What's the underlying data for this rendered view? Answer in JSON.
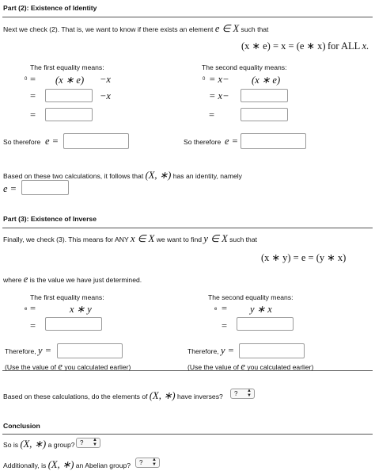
{
  "part2": {
    "title": "Part (2): Existence of Identity",
    "intro_text": "Next we check (2). That is, we want to know if there exists an element",
    "intro_math": "e ∈ X",
    "intro_suffix": "such that",
    "equation_left": "(x ∗ e) = x = (e ∗ x)",
    "equation_for": "for ALL",
    "equation_var": "x.",
    "first_label": "The first equality means:",
    "second_label": "The second equality means:",
    "first_row0": [
      "0",
      "=",
      "(x ∗ e)",
      "−x"
    ],
    "first_row1": [
      "=",
      "−x"
    ],
    "first_row2": [
      "="
    ],
    "second_row0": [
      "0",
      "= x−",
      "(x ∗ e)"
    ],
    "second_row1": [
      "= x−"
    ],
    "second_row2": [
      "="
    ],
    "so_therefore": "So therefore",
    "e_eq": "e =",
    "conclusion_text": "Based on these two calculations, it follows that",
    "conclusion_group": "(X, ∗)",
    "conclusion_suffix": "has an identity, namely",
    "e_line": "e ="
  },
  "part3": {
    "title": "Part (3): Existence of Inverse",
    "intro_text": "Finally, we check (3). This means for ANY",
    "intro_math1": "x ∈ X",
    "intro_mid": "we want to find",
    "intro_math2": "y ∈ X",
    "intro_suffix": "such that",
    "equation": "(x ∗ y) = e = (y ∗ x)",
    "where_prefix": "where",
    "where_var": "e",
    "where_suffix": "is the value we have just determined.",
    "first_label": "The first equality means:",
    "second_label": "The second equality means:",
    "first_row0": [
      "e",
      "=",
      "x ∗ y"
    ],
    "first_row1": [
      "="
    ],
    "second_row0": [
      "e",
      "=",
      "y ∗ x"
    ],
    "second_row1": [
      "="
    ],
    "therefore": "Therefore,",
    "y_eq": "y =",
    "use_prefix": "(Use the value of",
    "use_var": "e",
    "use_suffix": "you calculated earlier)",
    "question_text": "Based on these calculations, do the elements of",
    "question_group": "(X, ∗)",
    "question_suffix": "have inverses?",
    "select_value": "?"
  },
  "conclusion": {
    "title": "Conclusion",
    "q1_prefix": "So is",
    "q1_group": "(X, ∗)",
    "q1_suffix": "a group?",
    "q1_value": "?",
    "q2_prefix": "Additionally, is",
    "q2_group": "(X, ∗)",
    "q2_suffix": "an Abelian group?",
    "q2_value": "?"
  }
}
